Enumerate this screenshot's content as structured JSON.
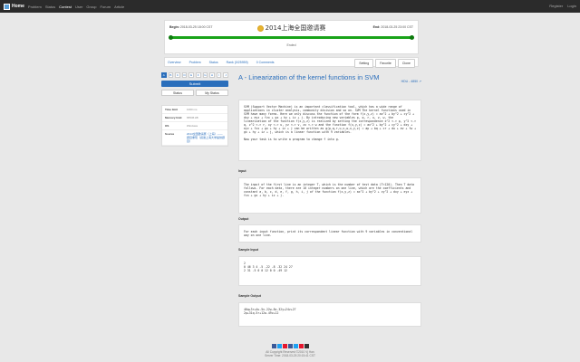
{
  "nav": {
    "brand": "Home",
    "items": [
      "Problem",
      "Status",
      "Contest",
      "User",
      "Group",
      "Forum",
      "Article"
    ],
    "right": [
      "Register",
      "Login"
    ]
  },
  "contest": {
    "begin_label": "Begin:",
    "begin": "2018-03-25 18:00 CST",
    "end_label": "End:",
    "end": "2018-03-25 23:00 CST",
    "title": "2014上海全国邀请赛",
    "status": "Ended",
    "progress": 1.0
  },
  "tabs": {
    "items": [
      "Overview",
      "Problem",
      "Status",
      "Rank (0/25959)",
      "0 Comments"
    ],
    "buttons": [
      "Setting",
      "Favorite",
      "Clone"
    ]
  },
  "sidebar": {
    "pages": [
      "A",
      "B",
      "C",
      "D",
      "E",
      "F",
      "G",
      "H",
      "I",
      "J"
    ],
    "submit": "Submit",
    "status": "Status",
    "my_status": "My Status",
    "info": [
      {
        "k": "Time limit",
        "v": "1000 ms"
      },
      {
        "k": "Memory limit",
        "v": "65536 kB"
      },
      {
        "k": "OS",
        "v": "Windows"
      },
      {
        "k": "Source",
        "v": "2014全国邀请赛（上海）——题目重现（感谢上海大学提供题目）"
      }
    ]
  },
  "problem": {
    "title": "A - Linearization of the kernel functions in SVM",
    "source": "HDU - 4850",
    "description": "SVM (Support Vector Machine) is an important classification tool, which has a wide range of applications in cluster analysis, community division and so on. SVM The kernel functions used in SVM have many forms. Here we only discuss the function of the form f(x,y,z) = ax^2 + by^2 + cy^2 + dxy + eyz + fzx + gx + hy + iz + j. By introducing new variables p, q, r, u, v, w, the linearization of the function f(x,y,z) is realized by setting the correspondence x^2 <-> p, y^2 <-> q, z^2 <-> r, xy <-> u, yz <-> v, zx <-> w and the function f(x,y,z) = ax^2 + by^2 + cy^2 + dxy + eyz + fzx + gx + hy + iz + j can be written as g(p,q,r,u,v,w,x,y,z) = ap + bq + cr + du + ev + fw + gx + hy + iz + j, which is a linear function with 9 variables.\n\nNow your task is to write a program to change f into g.",
    "input_label": "Input",
    "input": "The input of the first line is an integer T, which is the number of test data (T<120). Then T data follows. For each data, there are 10 integer numbers on one line, which are the coefficients and constant a, b, c, d, e, f, g, h, i, j of the function f(x,y,z) = ax^2 + by^2 + cy^2 + dxy + eyz + fzx + gx + hy + iz + j.",
    "output_label": "Output",
    "output": "For each input function, print its correspondent linear function with 9 variables in conventional way on one line.",
    "sample_input_label": "Sample Input",
    "sample_input": "2\n0 46 3 4 -5 -22 -8 -32 24 27\n2 31 -5 0 0 12 0 0 -49 12",
    "sample_output_label": "Sample Output",
    "sample_output": "46q+3r+4u-5v-22w-8x-32y+24z+27\n2p+31q-5r+12w-49z+12"
  },
  "footer": {
    "copyright": "All Copyright Reserved ©2010 Vj Han",
    "server_time": "Server Time: 2018-03-25 20:15:41 CST"
  },
  "colors": {
    "accent": "#2a6ebb",
    "progress": "#19a319",
    "navbar": "#2b2b2b"
  }
}
